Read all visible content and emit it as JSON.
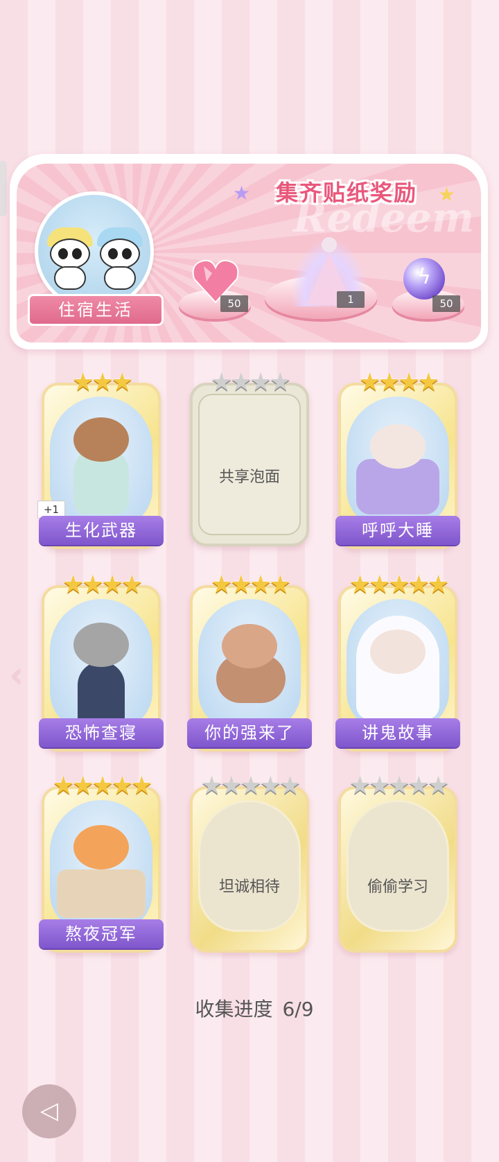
{
  "banner": {
    "title": "集齐贴纸奖励",
    "watermark": "Redeem",
    "theme_label": "住宿生活",
    "rewards": [
      {
        "icon": "pink-heart-gem-icon",
        "count": "50"
      },
      {
        "icon": "dress-outfit-icon",
        "count": "1"
      },
      {
        "icon": "purple-orb-icon",
        "count": "50"
      }
    ]
  },
  "cards": [
    {
      "label": "生化武器",
      "stars": "★★★",
      "state": "unlocked",
      "badge": "+1"
    },
    {
      "label": "共享泡面",
      "stars": "★★★★",
      "state": "locked"
    },
    {
      "label": "呼呼大睡",
      "stars": "★★★★",
      "state": "unlocked"
    },
    {
      "label": "恐怖查寝",
      "stars": "★★★★",
      "state": "unlocked"
    },
    {
      "label": "你的强来了",
      "stars": "★★★★",
      "state": "unlocked"
    },
    {
      "label": "讲鬼故事",
      "stars": "★★★★★",
      "state": "unlocked"
    },
    {
      "label": "熬夜冠军",
      "stars": "★★★★★",
      "state": "unlocked"
    },
    {
      "label": "坦诚相待",
      "stars": "★★★★★",
      "state": "locked"
    },
    {
      "label": "偷偷学习",
      "stars": "★★★★★",
      "state": "locked"
    }
  ],
  "progress": {
    "label": "收集进度",
    "value": "6/9"
  },
  "colors": {
    "accent": "#e8587c",
    "label_purple": "#8f66d8",
    "gold_star": "#f5c842"
  }
}
